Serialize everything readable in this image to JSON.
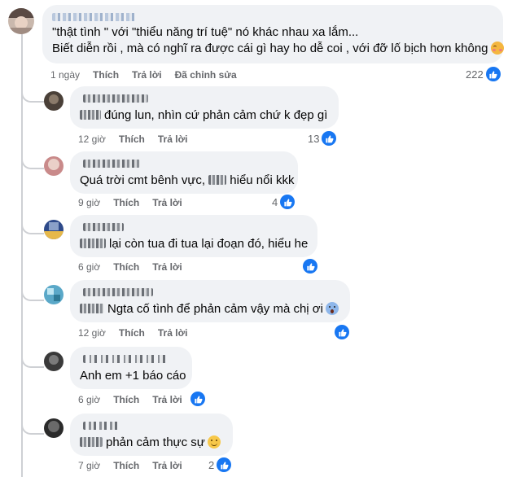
{
  "colors": {
    "accent": "#1877f2",
    "bubble": "#f0f2f5",
    "meta_text": "#65676b",
    "thread_line": "#ced0d4"
  },
  "top_comment": {
    "line1": "\"thật tình \" với \"thiểu năng trí tuệ\" nó khác nhau xa lắm...",
    "line2": "Biết diễn rồi , mà có nghĩ ra được cái gì hay ho dễ coi , với đỡ lố bịch hơn không",
    "emoji": "smiling-face-with-blush",
    "time": "1 ngày",
    "like": "Thích",
    "reply": "Trả lời",
    "edited": "Đã chỉnh sửa",
    "reactions": "222",
    "reaction_icon": "like-icon"
  },
  "replies": [
    {
      "text": "đúng lun, nhìn cứ phản cảm chứ k đẹp gì",
      "name_blurred": true,
      "text_prefix_blurred": true,
      "time": "12 giờ",
      "like": "Thích",
      "reply": "Trả lời",
      "reactions": "13"
    },
    {
      "text": "Quá trời cmt bênh vực, ",
      "text_suffix": "hiểu nổi kkk",
      "time": "9 giờ",
      "like": "Thích",
      "reply": "Trả lời",
      "reactions": "4"
    },
    {
      "text": "lại còn tua đi tua lại đoạn đó, hiểu he",
      "time": "6 giờ",
      "like": "Thích",
      "reply": "Trả lời",
      "reactions": ""
    },
    {
      "text": "Ngta cố tình để phản cảm vậy mà chị ơi",
      "emoji": "face-screaming",
      "time": "12 giờ",
      "like": "Thích",
      "reply": "Trả lời",
      "reactions": ""
    },
    {
      "text": "Anh em +1 báo cáo",
      "time": "6 giờ",
      "like": "Thích",
      "reply": "Trả lời",
      "reactions": ""
    },
    {
      "text": "phản cảm thực sự",
      "emoji": "smiling-face",
      "time": "7 giờ",
      "like": "Thích",
      "reply": "Trả lời",
      "reactions": "2"
    }
  ]
}
